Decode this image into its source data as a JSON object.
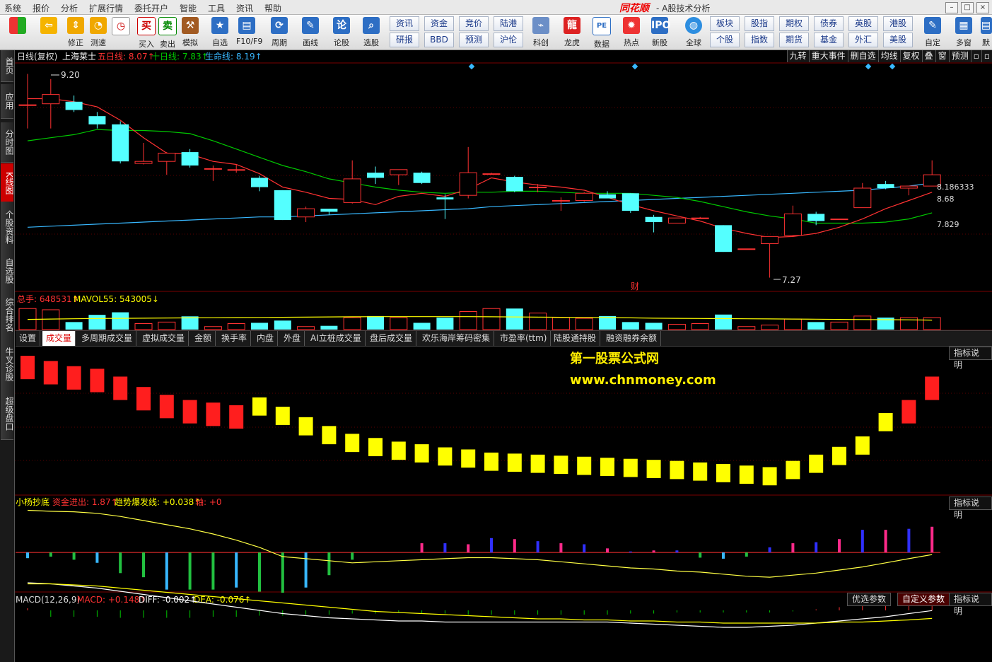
{
  "menu": [
    "系统",
    "报价",
    "分析",
    "扩展行情",
    "委托开户",
    "智能",
    "工具",
    "资讯",
    "帮助"
  ],
  "brand": "同花顺",
  "app_title": "- A股技术分析",
  "toolbar": {
    "big": [
      {
        "label": "",
        "icon": "layout-icon"
      },
      {
        "label": "",
        "icon": "back-arrow-icon"
      },
      {
        "label": "修正",
        "icon": "up-down-icon"
      },
      {
        "label": "测速",
        "icon": "clock-icon"
      },
      {
        "label": "买入",
        "icon": "buy-icon",
        "glyph": "买"
      },
      {
        "label": "卖出",
        "icon": "sell-icon",
        "glyph": "卖"
      },
      {
        "label": "模拟",
        "icon": "hammer-icon"
      },
      {
        "label": "自选",
        "icon": "star-icon"
      },
      {
        "label": "F10/F9",
        "icon": "f10-icon"
      },
      {
        "label": "周期",
        "icon": "cycle-icon"
      },
      {
        "label": "画线",
        "icon": "pen-icon"
      },
      {
        "label": "论股",
        "icon": "discuss-icon"
      },
      {
        "label": "选股",
        "icon": "select-icon"
      }
    ],
    "grid1": [
      [
        "资讯",
        "资金",
        "竞价",
        "陆港"
      ],
      [
        "研报",
        "BBD",
        "预测",
        "沪伦"
      ]
    ],
    "mid": [
      {
        "label": "科创",
        "icon": "kechuang-icon"
      },
      {
        "label": "龙虎",
        "icon": "dragon-icon"
      },
      {
        "label": "数据",
        "icon": "pe-icon"
      },
      {
        "label": "热点",
        "icon": "hot-icon"
      },
      {
        "label": "新股",
        "icon": "ipo-icon"
      },
      {
        "label": "全球",
        "icon": "globe-icon"
      }
    ],
    "grid2": [
      [
        "板块",
        "股指",
        "期权",
        "债券",
        "英股",
        "港股"
      ],
      [
        "个股",
        "指数",
        "期货",
        "基金",
        "外汇",
        "美股"
      ]
    ],
    "right": [
      {
        "label": "自定",
        "icon": "custom-icon"
      },
      {
        "label": "多窗",
        "icon": "multiwin-icon"
      },
      {
        "label": "默",
        "icon": "default-icon"
      }
    ]
  },
  "sidebar": [
    "首页",
    "应用",
    "分时图",
    "K线图",
    "个股资料",
    "自选股",
    "综合排名",
    "牛叉诊股",
    "超级盘口"
  ],
  "sidebar_active": 3,
  "main_header": {
    "prefix": "日线(复权)",
    "stock": "上海莱士",
    "ma5": "五日线: 8.07↑",
    "ma10": "十日线: 7.83↑",
    "life": "生命线: 8.19↑"
  },
  "top_right_buttons": [
    "九转",
    "重大事件",
    "删自选",
    "均线",
    "复权",
    "叠",
    "窗",
    "预测"
  ],
  "price_labels": {
    "high": "9.20",
    "low": "7.27",
    "r1": "8.186333",
    "r2": "8.68",
    "r3": "7.829",
    "cai": "财"
  },
  "volume_header": {
    "total": "总手: 648531↑",
    "mavol": "MAVOL55: 543005↓"
  },
  "tabs": [
    "设置",
    "成交量",
    "多周期成交量",
    "虚拟成交量",
    "金额",
    "换手率",
    "内盘",
    "外盘",
    "AI立桩成交量",
    "盘后成交量",
    "欢乐海岸筹码密集",
    "市盈率(ttm)",
    "陆股通持股",
    "融资融券余额"
  ],
  "tabs_active": 1,
  "explain_label": "指标说明",
  "watermark": [
    "第一股票公式网",
    "www.chnmoney.com"
  ],
  "ind2_header": {
    "name": "小杨抄底",
    "fund": "资金进出: 1.87↑",
    "trend": "趋势爆发线: +0.038↑",
    "axis": "轴: +0"
  },
  "macd_header": {
    "name": "MACD(12,26,9)",
    "macd": "MACD: +0.148↑",
    "diff": "DIFF: -0.002↑",
    "dea": "DEA: -0.076↑"
  },
  "macd_buttons": [
    "优选参数",
    "自定义参数",
    "指标说明"
  ],
  "macd_active": 1,
  "colors": {
    "up": "#ff3232",
    "down": "#54ffff",
    "ma5": "#ff3232",
    "ma10": "#00c800",
    "life": "#38b8ff",
    "yellow": "#ffff00"
  },
  "chart_data": {
    "type": "candlestick",
    "price_ylim": [
      7.15,
      9.35
    ],
    "candles": [
      {
        "o": 8.95,
        "h": 9.25,
        "l": 8.72,
        "c": 8.95
      },
      {
        "o": 8.96,
        "h": 9.2,
        "l": 8.72,
        "c": 9.05
      },
      {
        "o": 8.98,
        "h": 9.04,
        "l": 8.88,
        "c": 8.9
      },
      {
        "o": 8.84,
        "h": 8.88,
        "l": 8.72,
        "c": 8.76
      },
      {
        "o": 8.76,
        "h": 8.79,
        "l": 8.38,
        "c": 8.4
      },
      {
        "o": 8.38,
        "h": 8.58,
        "l": 8.37,
        "c": 8.4
      },
      {
        "o": 8.4,
        "h": 8.49,
        "l": 8.27,
        "c": 8.48
      },
      {
        "o": 8.49,
        "h": 8.52,
        "l": 8.34,
        "c": 8.36
      },
      {
        "o": 8.33,
        "h": 8.36,
        "l": 8.21,
        "c": 8.33
      },
      {
        "o": 8.32,
        "h": 8.37,
        "l": 8.29,
        "c": 8.32
      },
      {
        "o": 8.24,
        "h": 8.26,
        "l": 8.11,
        "c": 8.15
      },
      {
        "o": 8.12,
        "h": 8.12,
        "l": 7.83,
        "c": 7.83
      },
      {
        "o": 7.86,
        "h": 7.96,
        "l": 7.81,
        "c": 7.94
      },
      {
        "o": 7.94,
        "h": 7.94,
        "l": 7.88,
        "c": 7.91
      },
      {
        "o": 8.0,
        "h": 8.41,
        "l": 7.99,
        "c": 8.23
      },
      {
        "o": 8.29,
        "h": 8.35,
        "l": 8.18,
        "c": 8.24
      },
      {
        "o": 8.27,
        "h": 8.32,
        "l": 8.17,
        "c": 8.32
      },
      {
        "o": 8.29,
        "h": 8.3,
        "l": 8.18,
        "c": 8.19
      },
      {
        "o": 8.05,
        "h": 8.08,
        "l": 7.84,
        "c": 8.03
      },
      {
        "o": 8.07,
        "h": 8.54,
        "l": 8.04,
        "c": 8.29
      },
      {
        "o": 8.28,
        "h": 8.29,
        "l": 8.28,
        "c": 8.28
      },
      {
        "o": 8.25,
        "h": 8.26,
        "l": 8.1,
        "c": 8.11
      },
      {
        "o": 8.15,
        "h": 8.18,
        "l": 8.1,
        "c": 8.15
      },
      {
        "o": 8.02,
        "h": 8.05,
        "l": 7.92,
        "c": 8.02
      },
      {
        "o": 8.02,
        "h": 8.1,
        "l": 8.01,
        "c": 8.09
      },
      {
        "o": 8.08,
        "h": 8.11,
        "l": 8.04,
        "c": 8.04
      },
      {
        "o": 8.09,
        "h": 8.09,
        "l": 7.9,
        "c": 7.92
      },
      {
        "o": 7.86,
        "h": 7.88,
        "l": 7.71,
        "c": 7.81
      },
      {
        "o": 7.8,
        "h": 7.85,
        "l": 7.8,
        "c": 7.85
      },
      {
        "o": 7.85,
        "h": 7.86,
        "l": 7.85,
        "c": 7.85
      },
      {
        "o": 7.78,
        "h": 7.78,
        "l": 7.52,
        "c": 7.52
      },
      {
        "o": 7.55,
        "h": 7.55,
        "l": 7.55,
        "c": 7.55
      },
      {
        "o": 7.6,
        "h": 7.6,
        "l": 7.27,
        "c": 7.67
      },
      {
        "o": 7.68,
        "h": 7.97,
        "l": 7.67,
        "c": 7.89
      },
      {
        "o": 7.89,
        "h": 7.91,
        "l": 7.78,
        "c": 7.82
      },
      {
        "o": 7.84,
        "h": 7.84,
        "l": 7.84,
        "c": 7.84
      },
      {
        "o": 7.95,
        "h": 8.19,
        "l": 7.95,
        "c": 8.14
      },
      {
        "o": 8.18,
        "h": 8.21,
        "l": 8.13,
        "c": 8.14
      },
      {
        "o": 8.14,
        "h": 8.16,
        "l": 8.07,
        "c": 8.16
      },
      {
        "o": 8.16,
        "h": 8.41,
        "l": 8.16,
        "c": 8.27
      }
    ],
    "ma5": [
      9.01,
      9.01,
      8.98,
      8.93,
      8.8,
      8.63,
      8.48,
      8.47,
      8.4,
      8.37,
      8.28,
      8.15,
      8.1,
      8.04,
      8.03,
      7.98,
      8.06,
      8.09,
      8.06,
      8.13,
      8.24,
      8.2,
      8.17,
      8.15,
      8.12,
      8.05,
      7.98,
      7.92,
      7.87,
      7.82,
      7.75,
      7.7,
      7.66,
      7.67,
      7.7,
      7.76,
      7.84,
      7.94,
      8.02,
      8.1
    ],
    "ma10": [
      8.6,
      8.63,
      8.66,
      8.71,
      8.7,
      8.7,
      8.69,
      8.67,
      8.6,
      8.52,
      8.44,
      8.36,
      8.3,
      8.23,
      8.19,
      8.15,
      8.12,
      8.1,
      8.09,
      8.1,
      8.1,
      8.11,
      8.11,
      8.1,
      8.09,
      8.09,
      8.09,
      8.07,
      8.05,
      8.01,
      7.96,
      7.91,
      7.87,
      7.84,
      7.8,
      7.8,
      7.8,
      7.81,
      7.84,
      7.9
    ],
    "life": [
      7.76,
      7.77,
      7.78,
      7.79,
      7.8,
      7.81,
      7.82,
      7.83,
      7.84,
      7.85,
      7.86,
      7.86,
      7.87,
      7.88,
      7.89,
      7.9,
      7.91,
      7.92,
      7.93,
      7.94,
      7.96,
      7.97,
      7.98,
      7.99,
      8.0,
      8.01,
      8.02,
      8.03,
      8.04,
      8.05,
      8.06,
      8.07,
      8.08,
      8.09,
      8.1,
      8.11,
      8.12,
      8.14,
      8.16,
      8.19
    ],
    "volume": [
      620,
      612,
      530,
      578,
      595,
      520,
      530,
      568,
      500,
      520,
      525,
      540,
      500,
      505,
      560,
      570,
      560,
      525,
      560,
      600,
      620,
      620,
      590,
      560,
      555,
      570,
      530,
      525,
      515,
      520,
      580,
      500,
      510,
      550,
      530,
      530,
      570,
      560,
      560,
      560
    ],
    "volume_max": 640,
    "mavol55": [
      548,
      550,
      552,
      554,
      555,
      556,
      557,
      558,
      559,
      560,
      561,
      562,
      563,
      564,
      565,
      566,
      566,
      566,
      566,
      566,
      565,
      564,
      563,
      562,
      561,
      560,
      558,
      556,
      555,
      554,
      553,
      552,
      551,
      550,
      549,
      548,
      547,
      546,
      545,
      543
    ],
    "hist3": [
      10.5,
      9.5,
      8.5,
      8.0,
      6.5,
      4.5,
      3.0,
      2.0,
      1.5,
      1.0,
      -1.0,
      -2.8,
      -4.8,
      -6.5,
      -8.0,
      -8.8,
      -9.5,
      -10.0,
      -10.6,
      -11.0,
      -11.6,
      -11.8,
      -12.0,
      -12.2,
      -12.4,
      -12.6,
      -12.8,
      -13.0,
      -13.2,
      -13.5,
      -13.8,
      -14.1,
      -14.4,
      -13.2,
      -12.0,
      -10.5,
      -8.5,
      -4.0,
      2.0,
      6.5
    ],
    "hist3_ylim": [
      -16,
      12
    ],
    "fund_bars": [
      -0.55,
      -0.4,
      -0.7,
      -1.0,
      -2.0,
      -2.4,
      -3.6,
      -3.6,
      -3.6,
      -3.4,
      -3.8,
      -3.9,
      -3.4,
      -2.2,
      -0.7,
      0,
      0,
      0.9,
      0.9,
      0.8,
      1.4,
      1.3,
      1.1,
      0.9,
      0.8,
      0.4,
      0.1,
      0.2,
      0.2,
      -0.5,
      -0.6,
      -0.4,
      0.5,
      0.9,
      1.0,
      1.3,
      2.2,
      2.2,
      2.3,
      2.5
    ],
    "trend_line": [
      4.1,
      4.0,
      3.95,
      3.8,
      3.5,
      3.1,
      2.7,
      2.3,
      1.8,
      1.2,
      0.5,
      -0.4,
      -0.6,
      -0.8,
      -1.0,
      -0.9,
      -0.8,
      -0.7,
      -0.6,
      -0.5,
      -0.5,
      -0.6,
      -0.7,
      -0.9,
      -1.1,
      -1.3,
      -1.5,
      -1.6,
      -1.8,
      -1.9,
      -2.1,
      -2.3,
      -2.4,
      -2.2,
      -2.0,
      -1.7,
      -1.4,
      -1.0,
      -0.6,
      -0.2
    ],
    "ind2_ylim": [
      -3.9,
      4.2
    ],
    "macd_hist": [
      0.02,
      -0.06,
      -0.06,
      -0.06,
      -0.07,
      -0.07,
      -0.07,
      -0.07,
      -0.06,
      -0.06,
      -0.05,
      -0.05,
      -0.04,
      -0.04,
      -0.03,
      -0.03,
      -0.02,
      -0.03,
      -0.03,
      -0.04,
      -0.04,
      -0.04,
      -0.04,
      -0.04,
      -0.04,
      -0.04,
      -0.03,
      -0.03,
      -0.02,
      -0.02,
      -0.02,
      -0.02,
      -0.02,
      -0.01,
      0.01,
      0.03,
      0.06,
      0.08,
      0.12,
      0.148
    ],
    "diff": [
      0.26,
      0.25,
      0.23,
      0.21,
      0.18,
      0.15,
      0.12,
      0.09,
      0.06,
      0.03,
      0.0,
      -0.03,
      -0.05,
      -0.07,
      -0.08,
      -0.09,
      -0.1,
      -0.1,
      -0.11,
      -0.11,
      -0.11,
      -0.11,
      -0.11,
      -0.11,
      -0.11,
      -0.11,
      -0.12,
      -0.13,
      -0.14,
      -0.15,
      -0.16,
      -0.16,
      -0.15,
      -0.14,
      -0.12,
      -0.1,
      -0.08,
      -0.06,
      -0.03,
      -0.002
    ],
    "dea": [
      0.25,
      0.25,
      0.24,
      0.23,
      0.21,
      0.19,
      0.17,
      0.15,
      0.13,
      0.11,
      0.09,
      0.07,
      0.05,
      0.03,
      0.01,
      -0.01,
      -0.02,
      -0.03,
      -0.04,
      -0.05,
      -0.06,
      -0.07,
      -0.08,
      -0.08,
      -0.09,
      -0.09,
      -0.1,
      -0.1,
      -0.11,
      -0.11,
      -0.12,
      -0.12,
      -0.12,
      -0.12,
      -0.12,
      -0.11,
      -0.11,
      -0.1,
      -0.09,
      -0.076
    ],
    "macd_ylim": [
      -0.22,
      0.3
    ]
  }
}
